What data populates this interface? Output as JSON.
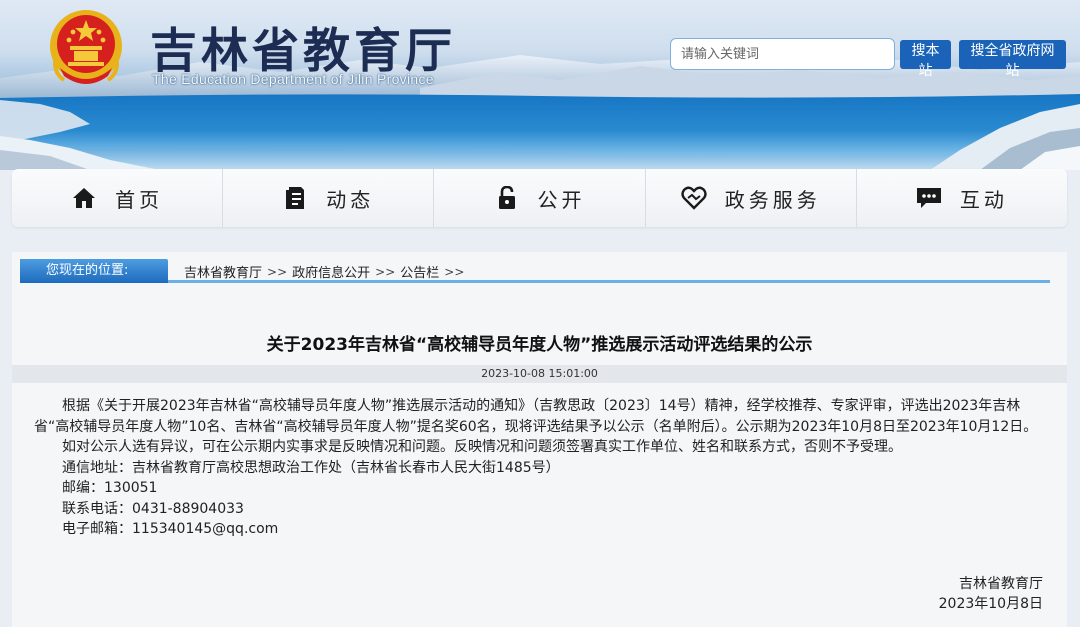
{
  "header": {
    "title": "吉林省教育厅",
    "subtitle": "The Education Department of Jilin Province",
    "search": {
      "placeholder": "请输入关键词",
      "value": ""
    },
    "btn_site": "搜本站",
    "btn_province": "搜全省政府网站"
  },
  "nav": {
    "items": [
      {
        "label": "首页",
        "icon": "home-icon"
      },
      {
        "label": "动态",
        "icon": "document-icon"
      },
      {
        "label": "公开",
        "icon": "lock-icon"
      },
      {
        "label": "政务服务",
        "icon": "handshake-heart-icon"
      },
      {
        "label": "互动",
        "icon": "chat-icon"
      }
    ]
  },
  "breadcrumb": {
    "label": "您现在的位置:",
    "items": [
      "吉林省教育厅",
      "政府信息公开",
      "公告栏"
    ],
    "separator": ">>"
  },
  "article": {
    "title": "关于2023年吉林省“高校辅导员年度人物”推选展示活动评选结果的公示",
    "datetime": "2023-10-08 15:01:00",
    "paragraph1": "根据《关于开展2023年吉林省“高校辅导员年度人物”推选展示活动的通知》（吉教思政〔2023〕14号）精神，经学校推荐、专家评审，评选出2023年吉林省“高校辅导员年度人物”10名、吉林省“高校辅导员年度人物”提名奖60名，现将评选结果予以公示（名单附后）。公示期为2023年10月8日至2023年10月12日。",
    "paragraph2": "如对公示人选有异议，可在公示期内实事求是反映情况和问题。反映情况和问题须签署真实工作单位、姓名和联系方式，否则不予受理。",
    "address": "通信地址：吉林省教育厅高校思想政治工作处（吉林省长春市人民大街1485号）",
    "postcode": "邮编：130051",
    "phone": "联系电话：0431-88904033",
    "email": "电子邮箱：115340145@qq.com",
    "signature_org": "吉林省教育厅",
    "signature_date": "2023年10月8日"
  },
  "colors": {
    "accent": "#1a63b8",
    "title_text": "#1c2c52",
    "crumb_underline": "#6ab0e6"
  }
}
